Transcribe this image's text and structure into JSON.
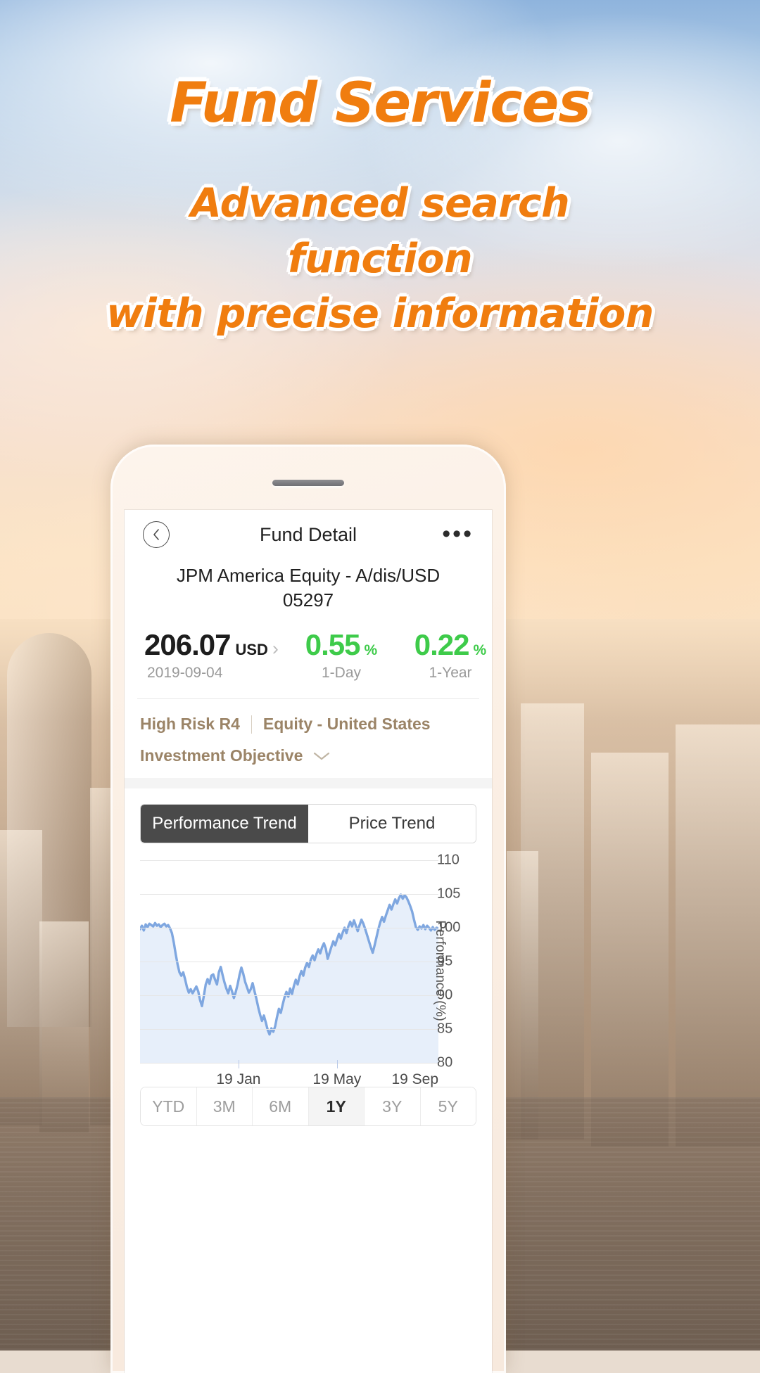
{
  "poster": {
    "title": "Fund Services",
    "subtitle_lines": [
      "Advanced search",
      "function",
      "with precise information"
    ],
    "accent_color": "#F07D0F"
  },
  "phone": {
    "navbar": {
      "back_icon": "chevron-left-icon",
      "title": "Fund Detail",
      "more_icon": "ellipsis-icon"
    },
    "fund": {
      "name": "JPM America Equity - A/dis/USD",
      "code": "05297",
      "price_value": "206.07",
      "price_currency": "USD",
      "price_chevron": "›",
      "price_date": "2019-09-04",
      "change_1day_value": "0.55",
      "change_1day_symbol": "%",
      "change_1day_label": "1-Day",
      "change_1year_value": "0.22",
      "change_1year_symbol": "%",
      "change_1year_label": "1-Year",
      "positive_color": "#3ECB4A"
    },
    "risk": {
      "level": "High Risk  R4",
      "category": "Equity - United States",
      "objective_label": "Investment Objective",
      "objective_chevron": "⌄",
      "text_color": "#9B8467"
    },
    "trend_tabs": [
      {
        "label": "Performance Trend",
        "active": true
      },
      {
        "label": "Price Trend",
        "active": false
      }
    ],
    "range_buttons": [
      {
        "label": "YTD",
        "active": false
      },
      {
        "label": "3M",
        "active": false
      },
      {
        "label": "6M",
        "active": false
      },
      {
        "label": "1Y",
        "active": true
      },
      {
        "label": "3Y",
        "active": false
      },
      {
        "label": "5Y",
        "active": false
      }
    ]
  },
  "chart_data": {
    "type": "line",
    "title": "Performance Trend",
    "xlabel": "",
    "ylabel": "Performance (%)",
    "ylim": [
      80,
      110
    ],
    "yticks": [
      110,
      105,
      100,
      95,
      90,
      85,
      80
    ],
    "xticks": [
      "19 Jan",
      "19 May",
      "19 Sep"
    ],
    "xtick_positions": [
      0.33,
      0.66,
      1.0
    ],
    "grid": true,
    "legend": "none",
    "line_color": "#7FA7E0",
    "fill_color": "#E7EFFA",
    "series": [
      {
        "name": "JPM America Equity - A/dis/USD",
        "values": [
          99.8,
          100.3,
          99.6,
          100.5,
          100.1,
          100.6,
          100.4,
          100.2,
          100.7,
          100.3,
          100.5,
          100.1,
          100.4,
          100.6,
          100.2,
          100.4,
          99.9,
          99.2,
          97.8,
          96.1,
          94.6,
          93.4,
          92.9,
          93.4,
          92.4,
          91.2,
          90.4,
          90.9,
          90.3,
          90.8,
          91.3,
          90.6,
          89.3,
          88.4,
          89.9,
          91.6,
          92.4,
          91.7,
          92.9,
          93.1,
          92.3,
          91.6,
          93.4,
          94.2,
          93.0,
          91.9,
          91.0,
          90.3,
          91.4,
          90.6,
          89.6,
          90.5,
          91.6,
          93.0,
          94.1,
          93.2,
          92.0,
          91.2,
          90.4,
          90.9,
          91.8,
          90.6,
          89.5,
          88.2,
          87.1,
          86.2,
          87.0,
          86.0,
          84.9,
          84.2,
          85.1,
          84.6,
          85.4,
          86.8,
          88.0,
          87.4,
          88.6,
          89.7,
          90.5,
          89.8,
          91.0,
          90.2,
          91.4,
          92.3,
          91.6,
          92.8,
          93.6,
          92.9,
          94.1,
          94.8,
          94.2,
          95.3,
          95.9,
          95.2,
          96.1,
          96.8,
          96.2,
          97.1,
          97.7,
          96.9,
          95.4,
          96.3,
          97.2,
          98.0,
          97.4,
          98.3,
          99.1,
          98.4,
          99.3,
          100.0,
          99.2,
          100.2,
          100.9,
          100.2,
          101.1,
          100.3,
          99.5,
          100.4,
          101.2,
          100.6,
          99.8,
          98.9,
          98.0,
          97.1,
          96.3,
          97.4,
          98.6,
          99.8,
          100.8,
          101.6,
          100.9,
          101.8,
          102.6,
          103.4,
          102.7,
          103.5,
          104.2,
          103.6,
          104.4,
          104.9,
          104.3,
          104.8,
          104.5,
          103.9,
          103.2,
          102.4,
          101.2,
          100.1,
          99.7,
          100.2,
          99.9,
          100.4,
          99.8,
          100.3,
          100.0,
          99.6,
          100.1,
          99.7,
          100.0,
          99.9
        ]
      }
    ]
  }
}
